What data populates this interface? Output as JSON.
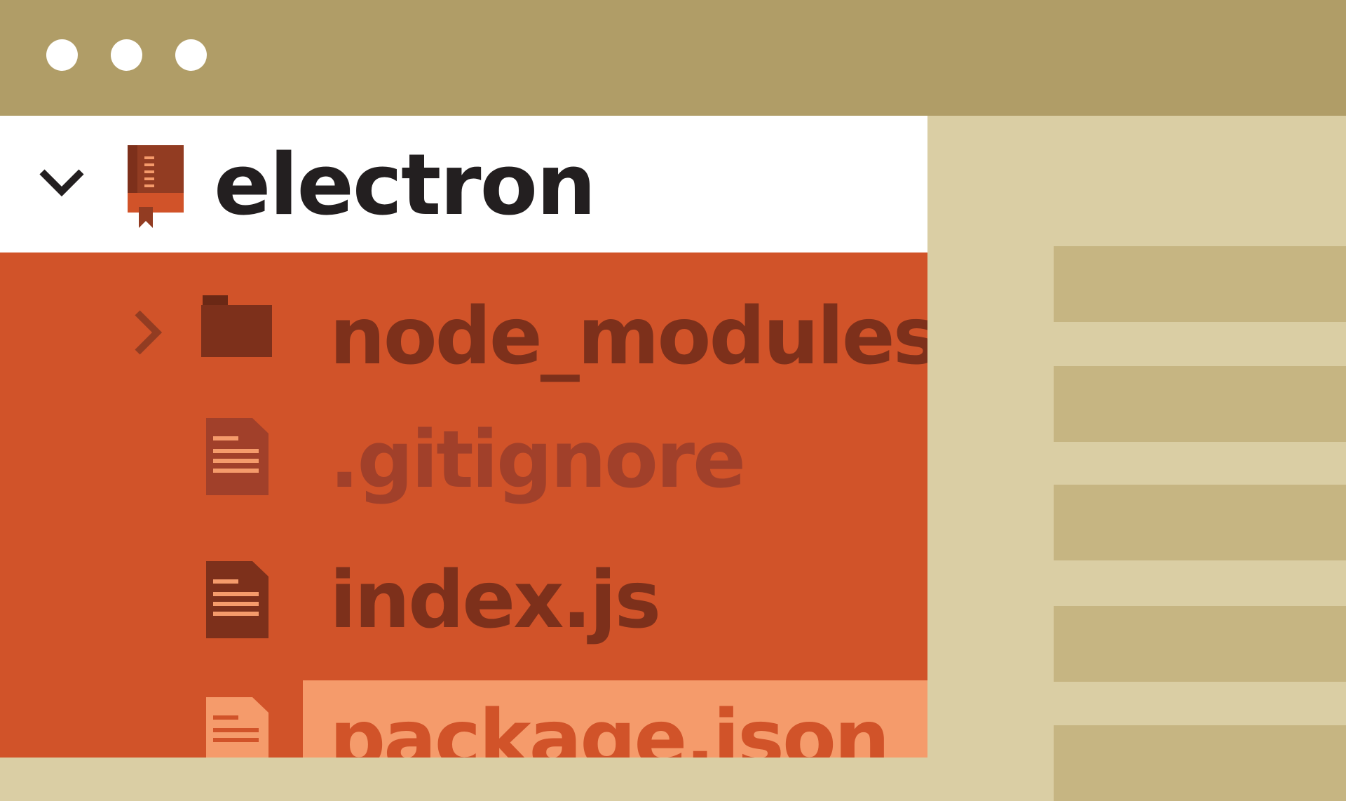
{
  "window": {
    "controls": [
      "close",
      "minimize",
      "maximize"
    ]
  },
  "tree": {
    "root": {
      "label": "electron",
      "icon": "repo-book-icon",
      "expanded": true
    },
    "items": [
      {
        "label": "node_modules",
        "icon": "folder-icon",
        "type": "folder",
        "expanded": false
      },
      {
        "label": ".gitignore",
        "icon": "file-icon",
        "type": "file",
        "dimmed": true
      },
      {
        "label": "index.js",
        "icon": "file-icon",
        "type": "file"
      },
      {
        "label": "package.json",
        "icon": "file-icon",
        "type": "file",
        "selected": true
      }
    ]
  },
  "editor": {
    "line_count_visible": 5
  },
  "colors": {
    "titlebar": "#B09D67",
    "tree_background": "#D15329",
    "selected_row": "#F59B6B",
    "root_row": "#FFFFFF",
    "editor_background": "#DACEA4",
    "editor_line": "#C6B582",
    "text_dark": "#7D301B",
    "root_text": "#231F20"
  }
}
